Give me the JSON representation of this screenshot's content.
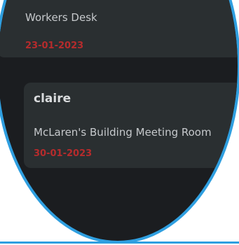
{
  "colors": {
    "ring": "#2f9fe0",
    "background": "#1b1d20",
    "card": "#2a2f31",
    "date": "#b62b2c"
  },
  "bookings": [
    {
      "location": "Workers Desk",
      "date": "23-01-2023"
    },
    {
      "user": "claire",
      "location": "McLaren's Building Meeting Room",
      "date": "30-01-2023"
    }
  ]
}
